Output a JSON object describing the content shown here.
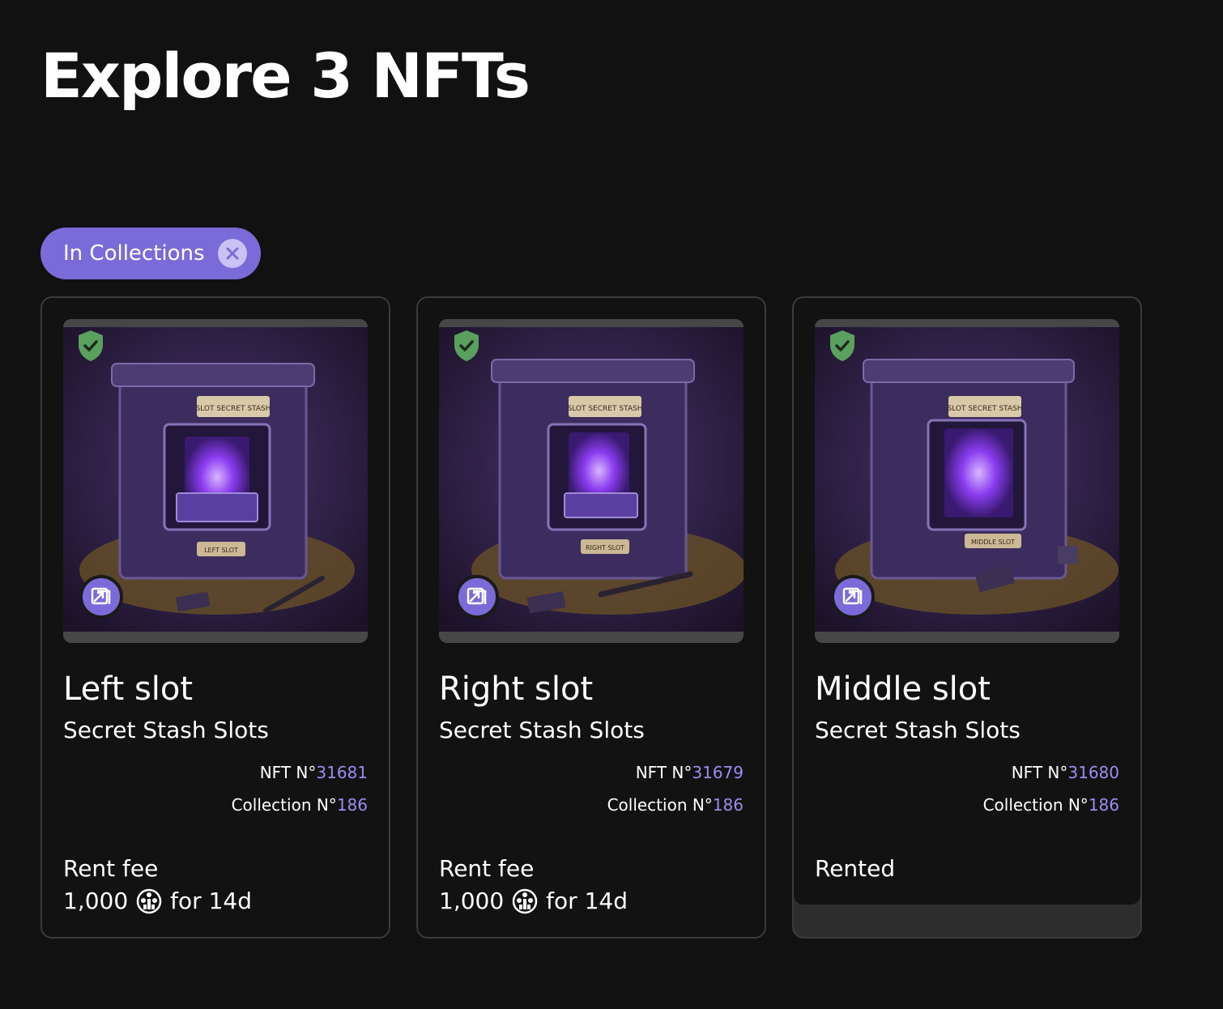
{
  "header": {
    "title": "Explore 3 NFTs"
  },
  "filters": {
    "chip_label": "In Collections"
  },
  "cards": [
    {
      "title": "Left slot",
      "collection_name": "Secret Stash Slots",
      "nft_prefix": "NFT N°",
      "nft_number": "31681",
      "collection_prefix": "Collection N°",
      "collection_number": "186",
      "status_label": "Rent fee",
      "price": "1,000",
      "duration": "for 14d",
      "art": {
        "sign_top": "SLOT SECRET STASH",
        "sign_bottom": "LEFT SLOT"
      }
    },
    {
      "title": "Right slot",
      "collection_name": "Secret Stash Slots",
      "nft_prefix": "NFT N°",
      "nft_number": "31679",
      "collection_prefix": "Collection N°",
      "collection_number": "186",
      "status_label": "Rent fee",
      "price": "1,000",
      "duration": "for 14d",
      "art": {
        "sign_top": "SLOT SECRET STASH",
        "sign_bottom": "RIGHT SLOT"
      }
    },
    {
      "title": "Middle slot",
      "collection_name": "Secret Stash Slots",
      "nft_prefix": "NFT N°",
      "nft_number": "31680",
      "collection_prefix": "Collection N°",
      "collection_number": "186",
      "status_label": "Rented",
      "art": {
        "sign_top": "SLOT SECRET STASH",
        "sign_bottom": "MIDDLE SLOT"
      }
    }
  ],
  "colors": {
    "background": "#111111",
    "accent": "#7b6bd9",
    "number_highlight": "#9b8df0",
    "verified_green": "#5aa05f",
    "card_border": "#3b3b3b"
  },
  "icons": {
    "chip_close": "close-circle-icon",
    "verified": "shield-check-icon",
    "type_badge": "nft-type-icon",
    "token": "token-coin-icon"
  }
}
